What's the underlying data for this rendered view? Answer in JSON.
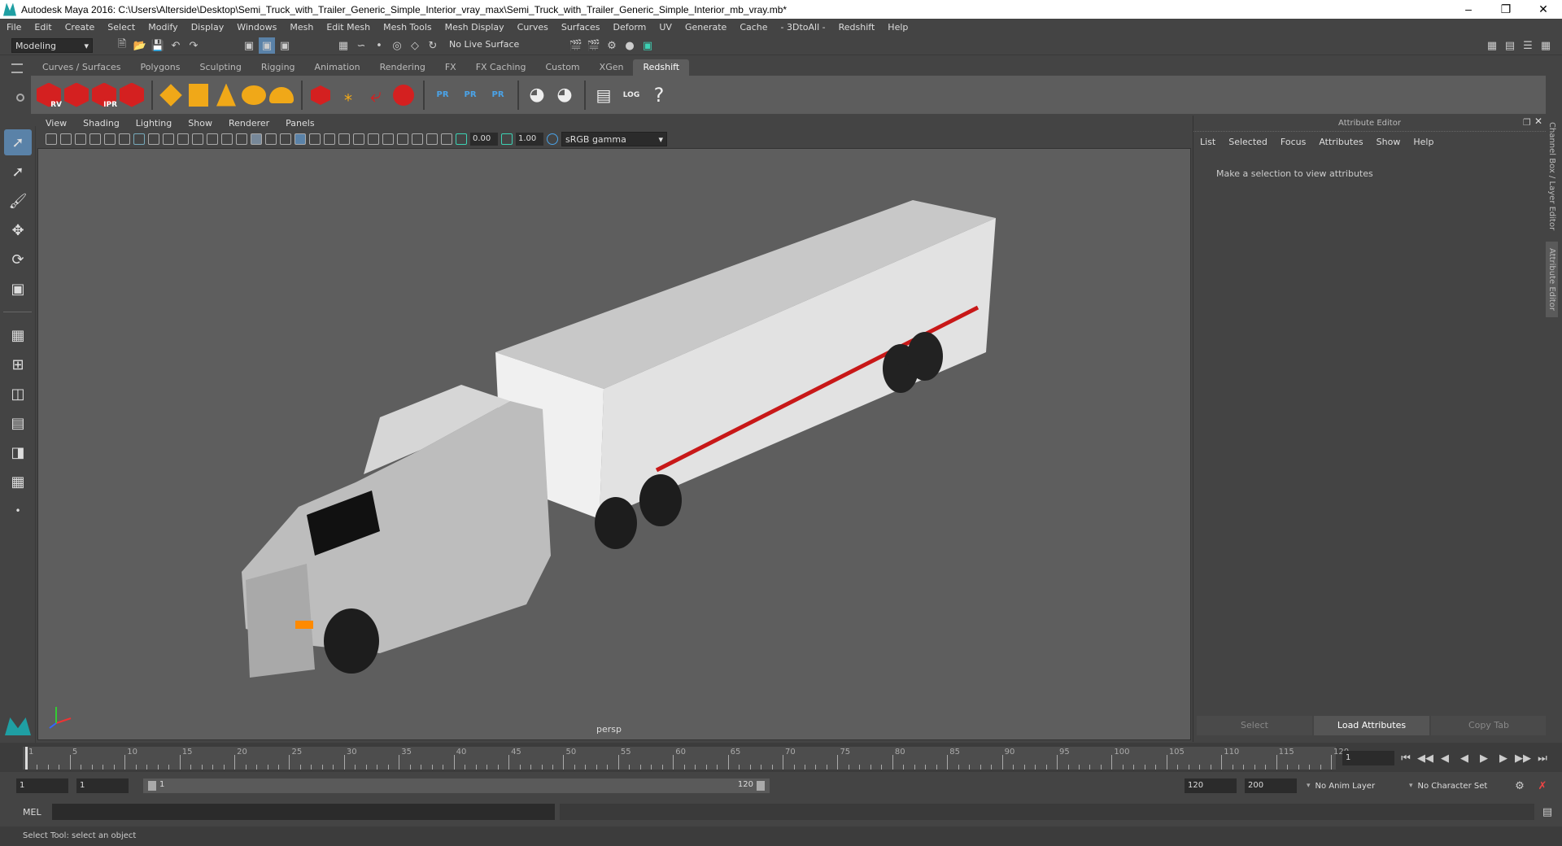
{
  "window": {
    "title": "Autodesk Maya 2016: C:\\Users\\Alterside\\Desktop\\Semi_Truck_with_Trailer_Generic_Simple_Interior_vray_max\\Semi_Truck_with_Trailer_Generic_Simple_Interior_mb_vray.mb*"
  },
  "menubar": [
    "File",
    "Edit",
    "Create",
    "Select",
    "Modify",
    "Display",
    "Windows",
    "Mesh",
    "Edit Mesh",
    "Mesh Tools",
    "Mesh Display",
    "Curves",
    "Surfaces",
    "Deform",
    "UV",
    "Generate",
    "Cache",
    "- 3DtoAll -",
    "Redshift",
    "Help"
  ],
  "statusline": {
    "mode": "Modeling",
    "live_surface": "No Live Surface"
  },
  "shelf_tabs": [
    "Curves / Surfaces",
    "Polygons",
    "Sculpting",
    "Rigging",
    "Animation",
    "Rendering",
    "FX",
    "FX Caching",
    "Custom",
    "XGen",
    "Redshift"
  ],
  "active_shelf": "Redshift",
  "shelf_labels": {
    "rv": "RV",
    "ipr": "IPR",
    "pr": "PR",
    "log": "LOG",
    "help": "?"
  },
  "viewport": {
    "menu": [
      "View",
      "Shading",
      "Lighting",
      "Show",
      "Renderer",
      "Panels"
    ],
    "exposure": "0.00",
    "gamma": "1.00",
    "colorspace": "sRGB gamma",
    "camera": "persp"
  },
  "attribute_editor": {
    "title": "Attribute Editor",
    "menu": [
      "List",
      "Selected",
      "Focus",
      "Attributes",
      "Show",
      "Help"
    ],
    "message": "Make a selection to view attributes",
    "buttons": [
      "Select",
      "Load Attributes",
      "Copy Tab"
    ]
  },
  "side_tabs": [
    "Channel Box / Layer Editor",
    "Attribute Editor"
  ],
  "timeline": {
    "ticks": [
      "1",
      "5",
      "10",
      "15",
      "20",
      "25",
      "30",
      "35",
      "40",
      "45",
      "50",
      "55",
      "60",
      "65",
      "70",
      "75",
      "80",
      "85",
      "90",
      "95",
      "100",
      "105",
      "110",
      "115",
      "120"
    ],
    "current_frame": "1"
  },
  "range": {
    "start": "1",
    "playback_start": "1",
    "slider_start": "1",
    "slider_end": "120",
    "playback_end": "120",
    "end": "200",
    "anim_layer": "No Anim Layer",
    "character_set": "No Character Set"
  },
  "cmdline": {
    "label": "MEL"
  },
  "helpline": "Select Tool: select an object"
}
